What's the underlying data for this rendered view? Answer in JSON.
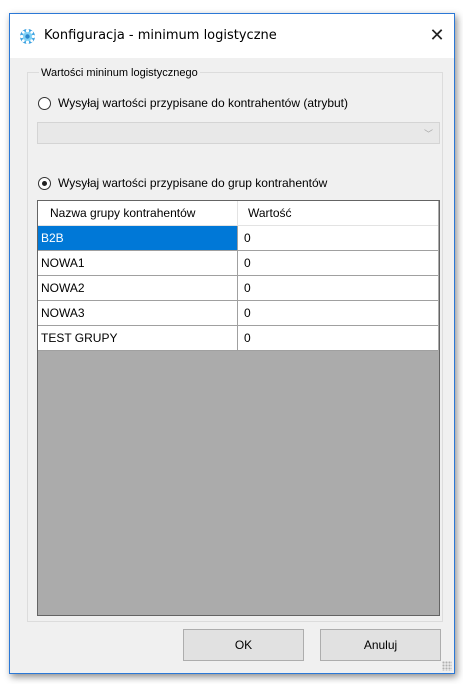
{
  "window": {
    "title": "Konfiguracja - minimum logistyczne",
    "icon": "gear-icon",
    "close_glyph": "✕"
  },
  "group": {
    "legend": "Wartości mininum logistycznego"
  },
  "options": [
    {
      "label": "Wysyłaj wartości przypisane do kontrahentów (atrybut)",
      "selected": false
    },
    {
      "label": "Wysyłaj wartości przypisane do grup kontrahentów",
      "selected": true
    }
  ],
  "attribute_select": {
    "value": "",
    "arrow": "﹀"
  },
  "table": {
    "columns": [
      "Nazwa grupy kontrahentów",
      "Wartość"
    ],
    "rows": [
      {
        "name": "B2B",
        "value": "0",
        "selected": true
      },
      {
        "name": "NOWA1",
        "value": "0",
        "selected": false
      },
      {
        "name": "NOWA2",
        "value": "0",
        "selected": false
      },
      {
        "name": "NOWA3",
        "value": "0",
        "selected": false
      },
      {
        "name": "TEST GRUPY",
        "value": "0",
        "selected": false
      }
    ]
  },
  "buttons": {
    "ok": "OK",
    "cancel": "Anuluj"
  },
  "colors": {
    "accent": "#0078d7",
    "dialog_bg": "#f0f0f0",
    "grid_empty_bg": "#ababab"
  }
}
